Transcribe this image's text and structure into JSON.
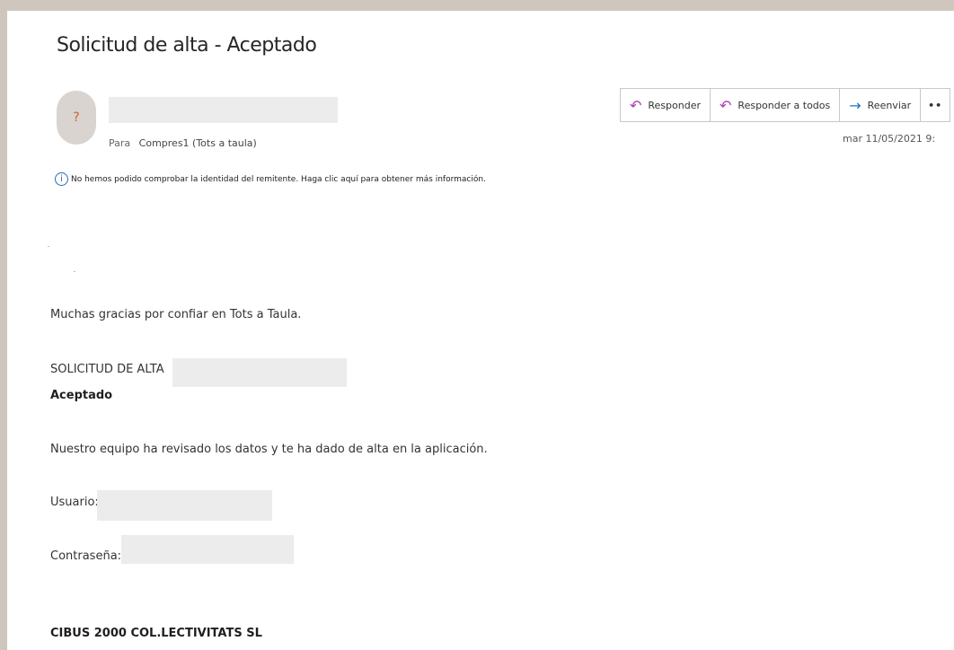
{
  "email": {
    "subject": "Solicitud de alta - Aceptado",
    "avatar_text": "?",
    "to_label": "Para",
    "to_value": "Compres1 (Tots a taula)",
    "warning": "No hemos podido comprobar la identidad del remitente. Haga clic aquí para obtener más información.",
    "warning_icon": "i",
    "date": "mar 11/05/2021 9:"
  },
  "actions": {
    "reply": "Responder",
    "reply_all": "Responder a todos",
    "forward": "Reenviar",
    "more": "••"
  },
  "body": {
    "thanks": "Muchas gracias por confiar en Tots a Taula.",
    "request_label": "SOLICITUD DE ALTA",
    "status": "Aceptado",
    "message": "Nuestro equipo ha revisado los datos y te ha dado de alta en la aplicación.",
    "user_label": "Usuario:",
    "password_label": "Contraseña:",
    "company": "CIBUS 2000 COL.LECTIVITATS SL"
  },
  "colors": {
    "accent_reply": "#b03ab8",
    "accent_forward": "#1a73c8",
    "info_icon": "#2b6cb0"
  }
}
